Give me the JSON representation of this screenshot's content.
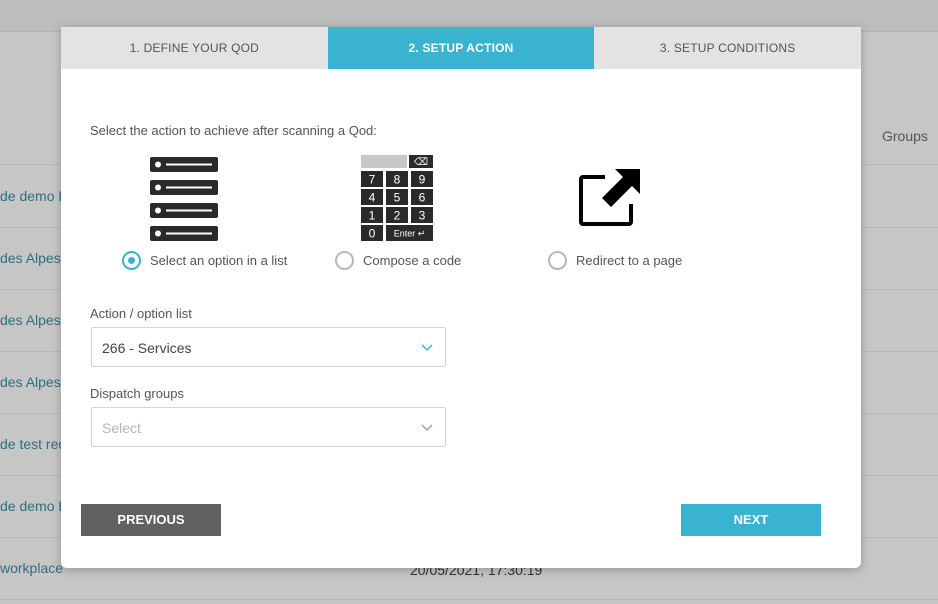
{
  "background": {
    "groups_header": "Groups",
    "rows": [
      {
        "name": "de demo B",
        "date": ""
      },
      {
        "name": "des Alpes",
        "date": ""
      },
      {
        "name": "des Alpes",
        "date": ""
      },
      {
        "name": "des Alpes",
        "date": ""
      },
      {
        "name": "de test rec",
        "date": ""
      },
      {
        "name": "de demo B",
        "date": ""
      },
      {
        "name": "workplace",
        "date": "20/05/2021, 17:30:19"
      }
    ]
  },
  "wizard": {
    "tabs": [
      {
        "label": "1. DEFINE YOUR QOD",
        "active": false
      },
      {
        "label": "2. SETUP ACTION",
        "active": true
      },
      {
        "label": "3. SETUP CONDITIONS",
        "active": false
      }
    ],
    "intro": "Select the action to achieve after scanning a Qod:",
    "choices": [
      {
        "label": "Select an option in a list",
        "icon": "list-icon",
        "selected": true
      },
      {
        "label": "Compose a code",
        "icon": "keypad-icon",
        "selected": false
      },
      {
        "label": "Redirect to a page",
        "icon": "external-link-icon",
        "selected": false
      }
    ],
    "keypad": {
      "keys": [
        "7",
        "8",
        "9",
        "4",
        "5",
        "6",
        "1",
        "2",
        "3",
        "0"
      ],
      "enter_label": "Enter ↵",
      "backspace_label": "⌫"
    },
    "action_list": {
      "label": "Action / option list",
      "value": "266 - Services"
    },
    "dispatch_groups": {
      "label": "Dispatch groups",
      "placeholder": "Select"
    },
    "buttons": {
      "previous": "PREVIOUS",
      "next": "NEXT"
    }
  },
  "colors": {
    "accent": "#3ab3d0",
    "secondary_button": "#616161",
    "overlay_background": "#c6c6c6"
  }
}
